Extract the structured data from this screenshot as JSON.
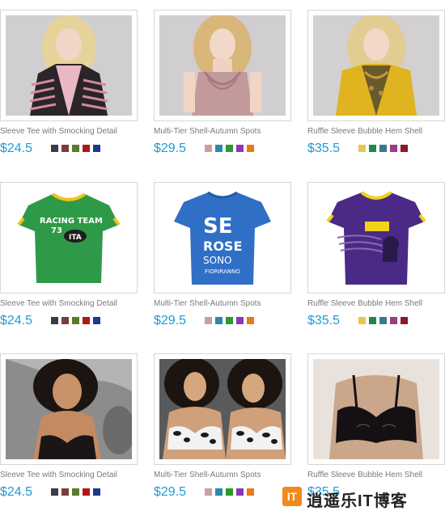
{
  "products": [
    {
      "title": "Sleeve Tee with Smocking Detail",
      "price": "$24.5",
      "image": "woman-striped-cardigan",
      "swatches": [
        "#3a3a4a",
        "#7a3e3e",
        "#5a7a2a",
        "#b01818",
        "#1a3a8a"
      ]
    },
    {
      "title": "Multi-Tier Shell-Autumn Spots",
      "price": "$29.5",
      "image": "woman-pink-ruffle-top",
      "swatches": [
        "#c8a0a0",
        "#2a8aaa",
        "#2a9a2a",
        "#8a38b8",
        "#e87a18"
      ]
    },
    {
      "title": "Ruffle Sleeve Bubble Hem Shell",
      "price": "$35.5",
      "image": "woman-yellow-cardigan",
      "swatches": [
        "#e8c84a",
        "#1a8a4a",
        "#3a7a8a",
        "#9a3a8a",
        "#8a1a2a"
      ]
    },
    {
      "title": "Sleeve Tee with Smocking Detail",
      "price": "$24.5",
      "image": "green-racing-team-tee",
      "swatches": [
        "#3a3a4a",
        "#7a3e3e",
        "#5a7a2a",
        "#b01818",
        "#1a3a8a"
      ]
    },
    {
      "title": "Multi-Tier Shell-Autumn Spots",
      "price": "$29.5",
      "image": "blue-se-rose-tee",
      "swatches": [
        "#c8a0a0",
        "#2a8aaa",
        "#2a9a2a",
        "#8a38b8",
        "#e87a18"
      ]
    },
    {
      "title": "Ruffle Sleeve Bubble Hem Shell",
      "price": "$35.5",
      "image": "purple-graphic-tee",
      "swatches": [
        "#e8c84a",
        "#1a8a4a",
        "#3a7a8a",
        "#9a3a8a",
        "#8a1a2a"
      ]
    },
    {
      "title": "Sleeve Tee with Smocking Detail",
      "price": "$24.5",
      "image": "woman-black-lingerie",
      "swatches": [
        "#3a3a4a",
        "#7a3e3e",
        "#5a7a2a",
        "#b01818",
        "#1a3a8a"
      ]
    },
    {
      "title": "Multi-Tier Shell-Autumn Spots",
      "price": "$29.5",
      "image": "two-women-animal-print-lingerie",
      "swatches": [
        "#c8a0a0",
        "#2a8aaa",
        "#2a9a2a",
        "#8a38b8",
        "#e87a18"
      ]
    },
    {
      "title": "Ruffle Sleeve Bubble Hem Shell",
      "price": "$35.5",
      "image": "woman-black-bra",
      "swatches": [
        "#e8c84a",
        "#1a8a4a",
        "#3a7a8a",
        "#9a3a8a",
        "#8a1a2a"
      ]
    }
  ],
  "tee_text": {
    "racing_team": "RACING TEAM",
    "racing_number": "73",
    "racing_badge": "ITA",
    "se_rose_lines": [
      "SE",
      "ROSE",
      "SONO",
      "FIORIRANNO"
    ]
  },
  "watermark": {
    "mark": "IT",
    "text": "逍遥乐IT博客"
  },
  "colors": {
    "price": "#1d9bd7",
    "title": "#7a7a7a",
    "border": "#d7d7d7"
  }
}
